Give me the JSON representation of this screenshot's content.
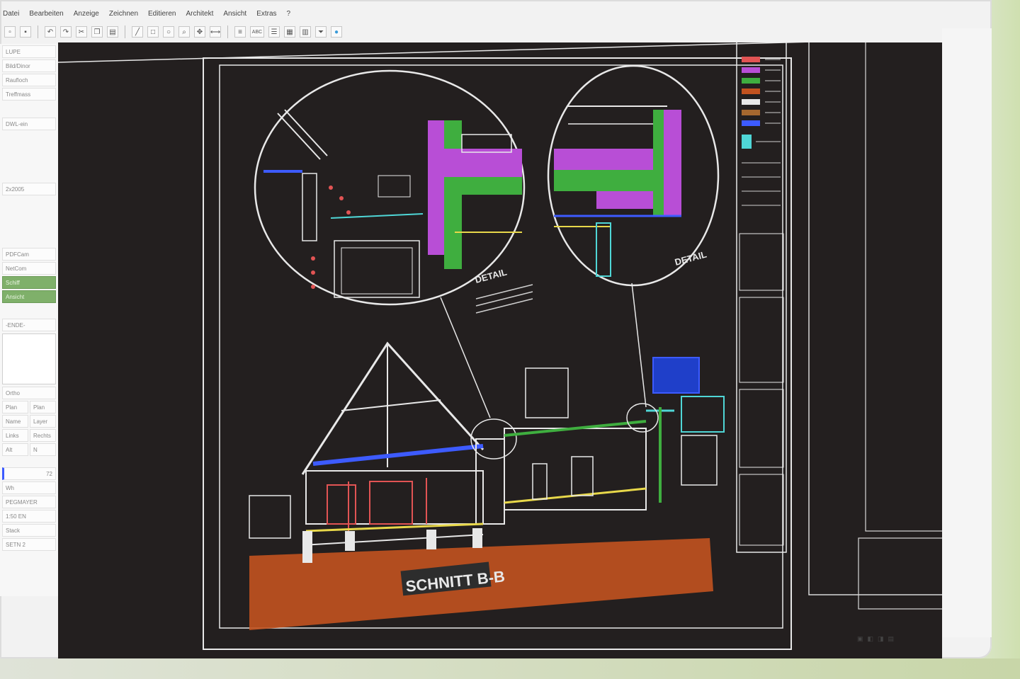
{
  "menubar": {
    "items": [
      "Datei",
      "Bearbeiten",
      "Anzeige",
      "Zeichnen",
      "Editieren",
      "Architekt",
      "Ansicht",
      "Extras",
      "?"
    ]
  },
  "toolbar": {
    "abc_label": "ABC"
  },
  "leftpanel": {
    "top_items": [
      "LUPE",
      "Bild/Dinor",
      "Raufloch",
      "Treffmass",
      "DWL-ein"
    ],
    "mid_label": "2x2005",
    "green_items": [
      "PDFCam",
      "NetCom",
      "Schiff",
      "Ansicht"
    ],
    "section_label": "-ENDE-",
    "sub_header": "Ortho",
    "grid_items": [
      "Plan",
      "Plan",
      "Name",
      "Layer",
      "Links",
      "Rechts",
      "Alt",
      "N"
    ],
    "value_72": "72",
    "wh_label": "Wh",
    "bottom_items": [
      "PEGMAYER",
      "1:50 EN",
      "Stack",
      "SETN 2"
    ]
  },
  "drawing": {
    "title": "SCHNITT B-B",
    "detail_label_1": "DETAIL",
    "detail_label_2": "DETAIL"
  },
  "colors": {
    "canvas_bg": "#231f1f",
    "line": "#e8e8e8",
    "insulation": "#b84ed6",
    "concrete": "#3fae3f",
    "ground": "#c2521f",
    "blue": "#3d5bff",
    "cyan": "#4fd6d6",
    "yellow": "#e8d84a"
  },
  "icons": [
    "save-icon",
    "undo-icon",
    "zoom-icon",
    "layer-icon",
    "grid-icon",
    "globe-icon"
  ]
}
